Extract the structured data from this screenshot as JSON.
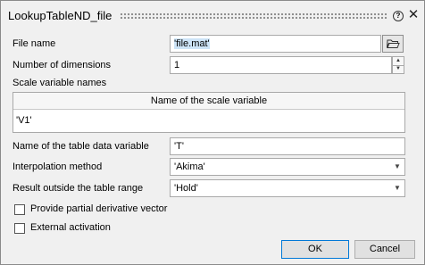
{
  "window": {
    "title": "LookupTableND_file"
  },
  "fields": {
    "file_name": {
      "label": "File name",
      "value": "'file.mat'"
    },
    "dimensions": {
      "label": "Number of dimensions",
      "value": "1"
    },
    "scale_names": {
      "label": "Scale variable names",
      "column_header": "Name of the scale variable",
      "rows": [
        "'V1'"
      ]
    },
    "table_var": {
      "label": "Name of the table data variable",
      "value": "'T'"
    },
    "interp": {
      "label": "Interpolation method",
      "value": "'Akima'"
    },
    "outside": {
      "label": "Result outside the table range",
      "value": "'Hold'"
    }
  },
  "checkboxes": {
    "partial": {
      "label": "Provide partial derivative vector",
      "checked": false
    },
    "external": {
      "label": "External activation",
      "checked": false
    }
  },
  "buttons": {
    "ok": "OK",
    "cancel": "Cancel"
  }
}
